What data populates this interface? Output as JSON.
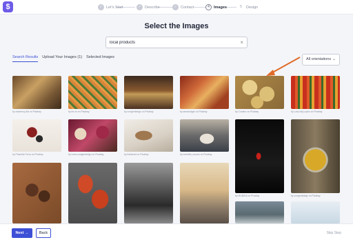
{
  "app": {
    "logo_glyph": "$",
    "accent": "#3d4fd6",
    "brand": "#6d5ce8"
  },
  "stepper": {
    "steps": [
      {
        "num": "1",
        "label": "Let's Start",
        "state": "done"
      },
      {
        "num": "2",
        "label": "Describe",
        "state": "done"
      },
      {
        "num": "3",
        "label": "Contact",
        "state": "done"
      },
      {
        "num": "4",
        "label": "Images",
        "state": "active"
      },
      {
        "num": "5",
        "label": "Design",
        "state": "future"
      }
    ]
  },
  "page": {
    "title": "Select the Images"
  },
  "search": {
    "value": "local products",
    "clear_glyph": "×"
  },
  "tabs": [
    {
      "label": "Search Results",
      "active": true
    },
    {
      "label": "Upload Your Images (1)",
      "active": false
    },
    {
      "label": "Selected Images",
      "active": false
    }
  ],
  "orientation": {
    "value": "All orientations",
    "chevron": "⌄"
  },
  "photos": [
    {
      "credit": "by orlarenuy-list on Pixabay"
    },
    {
      "credit": "by lev-m on Pixabay"
    },
    {
      "credit": "by congerdesign on Pixabay"
    },
    {
      "credit": "by annarodger on Pixabay"
    },
    {
      "credit": "by Couleur on Pixabay"
    },
    {
      "credit": "by Lola-inej-Lopez on Pixabay"
    },
    {
      "credit": "by Phanelie Ferra on Pixabay"
    },
    {
      "credit": "by Lena-congerdesign on Pixabay"
    },
    {
      "credit": "by frantsnet on Pixabay"
    },
    {
      "credit": "by meridith_mouse on Pixabay"
    },
    {
      "credit": "by MUBIDA on Pixabay"
    },
    {
      "credit": "by congerdesign on Pixabay"
    },
    {
      "credit": ""
    },
    {
      "credit": ""
    },
    {
      "credit": ""
    },
    {
      "credit": ""
    },
    {
      "credit": ""
    },
    {
      "credit": ""
    }
  ],
  "footer": {
    "next_label": "Next →",
    "back_label": "Back",
    "skip_label": "Skip Step"
  }
}
